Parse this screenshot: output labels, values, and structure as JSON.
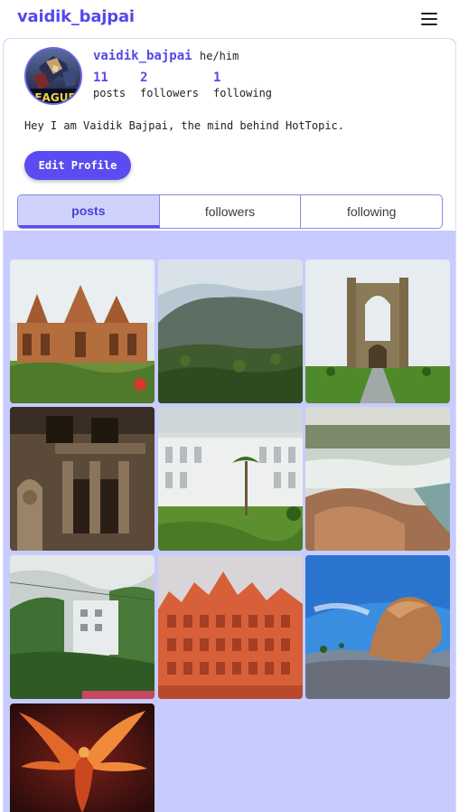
{
  "header": {
    "brand": "vaidik_bajpai",
    "menu_icon": "hamburger-menu-icon"
  },
  "profile": {
    "username": "vaidik_bajpai",
    "pronouns": "he/him",
    "avatar_text": "EAGUE",
    "stats": [
      {
        "value": "11",
        "label": "posts"
      },
      {
        "value": "2",
        "label": "followers"
      },
      {
        "value": "1",
        "label": "following"
      }
    ],
    "bio": "Hey I am Vaidik Bajpai, the mind behind HotTopic.",
    "edit_label": "Edit Profile"
  },
  "tabs": [
    {
      "label": "posts",
      "active": true
    },
    {
      "label": "followers",
      "active": false
    },
    {
      "label": "following",
      "active": false
    }
  ],
  "colors": {
    "accent": "#5648e8",
    "grid_background": "#c7cbfd",
    "active_tab": "#cfd3fc"
  },
  "posts_count_visible": 10
}
